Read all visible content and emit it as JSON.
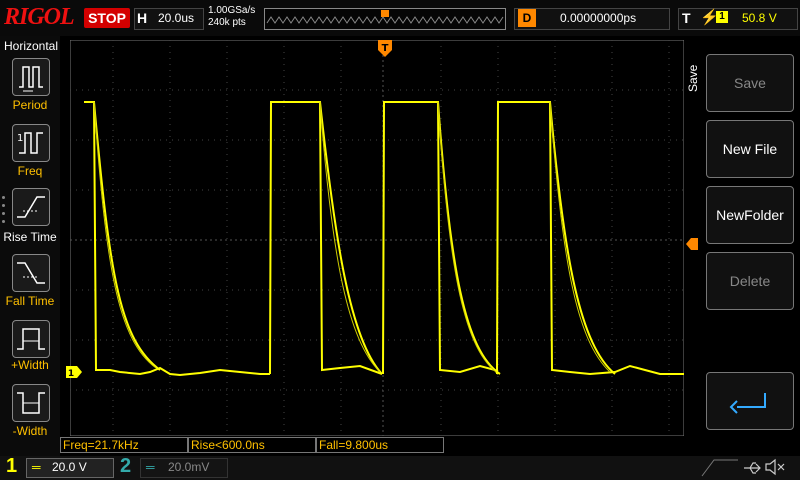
{
  "header": {
    "logo": "RIGOL",
    "run_state": "STOP",
    "timebase_label": "H",
    "timebase_scale": "20.0us",
    "sample_rate": "1.00GSa/s",
    "memory_depth": "240k pts",
    "delay_label": "D",
    "delay_value": "0.00000000ps",
    "trigger_label": "T",
    "trigger_source": "1",
    "trigger_level": "50.8 V"
  },
  "left_menu": {
    "title": "Horizontal",
    "items": [
      {
        "label": "Period",
        "icon": "period-icon"
      },
      {
        "label": "Freq",
        "icon": "freq-icon"
      },
      {
        "label": "Rise Time",
        "icon": "rise-time-icon"
      },
      {
        "label": "Fall Time",
        "icon": "fall-time-icon"
      },
      {
        "label": "+Width",
        "icon": "positive-width-icon"
      },
      {
        "label": "-Width",
        "icon": "negative-width-icon"
      }
    ]
  },
  "right_menu": {
    "title": "Save",
    "buttons": [
      {
        "label": "Save",
        "enabled": false
      },
      {
        "label": "New File",
        "enabled": true
      },
      {
        "label": "NewFolder",
        "enabled": true
      },
      {
        "label": "Delete",
        "enabled": false
      }
    ],
    "return_icon": "return-arrow-icon"
  },
  "measurements": {
    "freq": "Freq=21.7kHz",
    "rise": "Rise<600.0ns",
    "fall": "Fall=9.800us"
  },
  "channels": {
    "ch1": {
      "number": "1",
      "scale": "20.0 V",
      "color": "#ffff00"
    },
    "ch2": {
      "number": "2",
      "scale": "20.0mV",
      "color": "#33aaaa"
    }
  },
  "markers": {
    "ch1_ground": "1",
    "trigger_position": "T"
  },
  "colors": {
    "trace": "#ffff00",
    "stop": "#d40000",
    "accent": "#ff8800",
    "measure_text": "#ffc000"
  },
  "status_icons": [
    "usb-icon",
    "mute-icon"
  ]
}
